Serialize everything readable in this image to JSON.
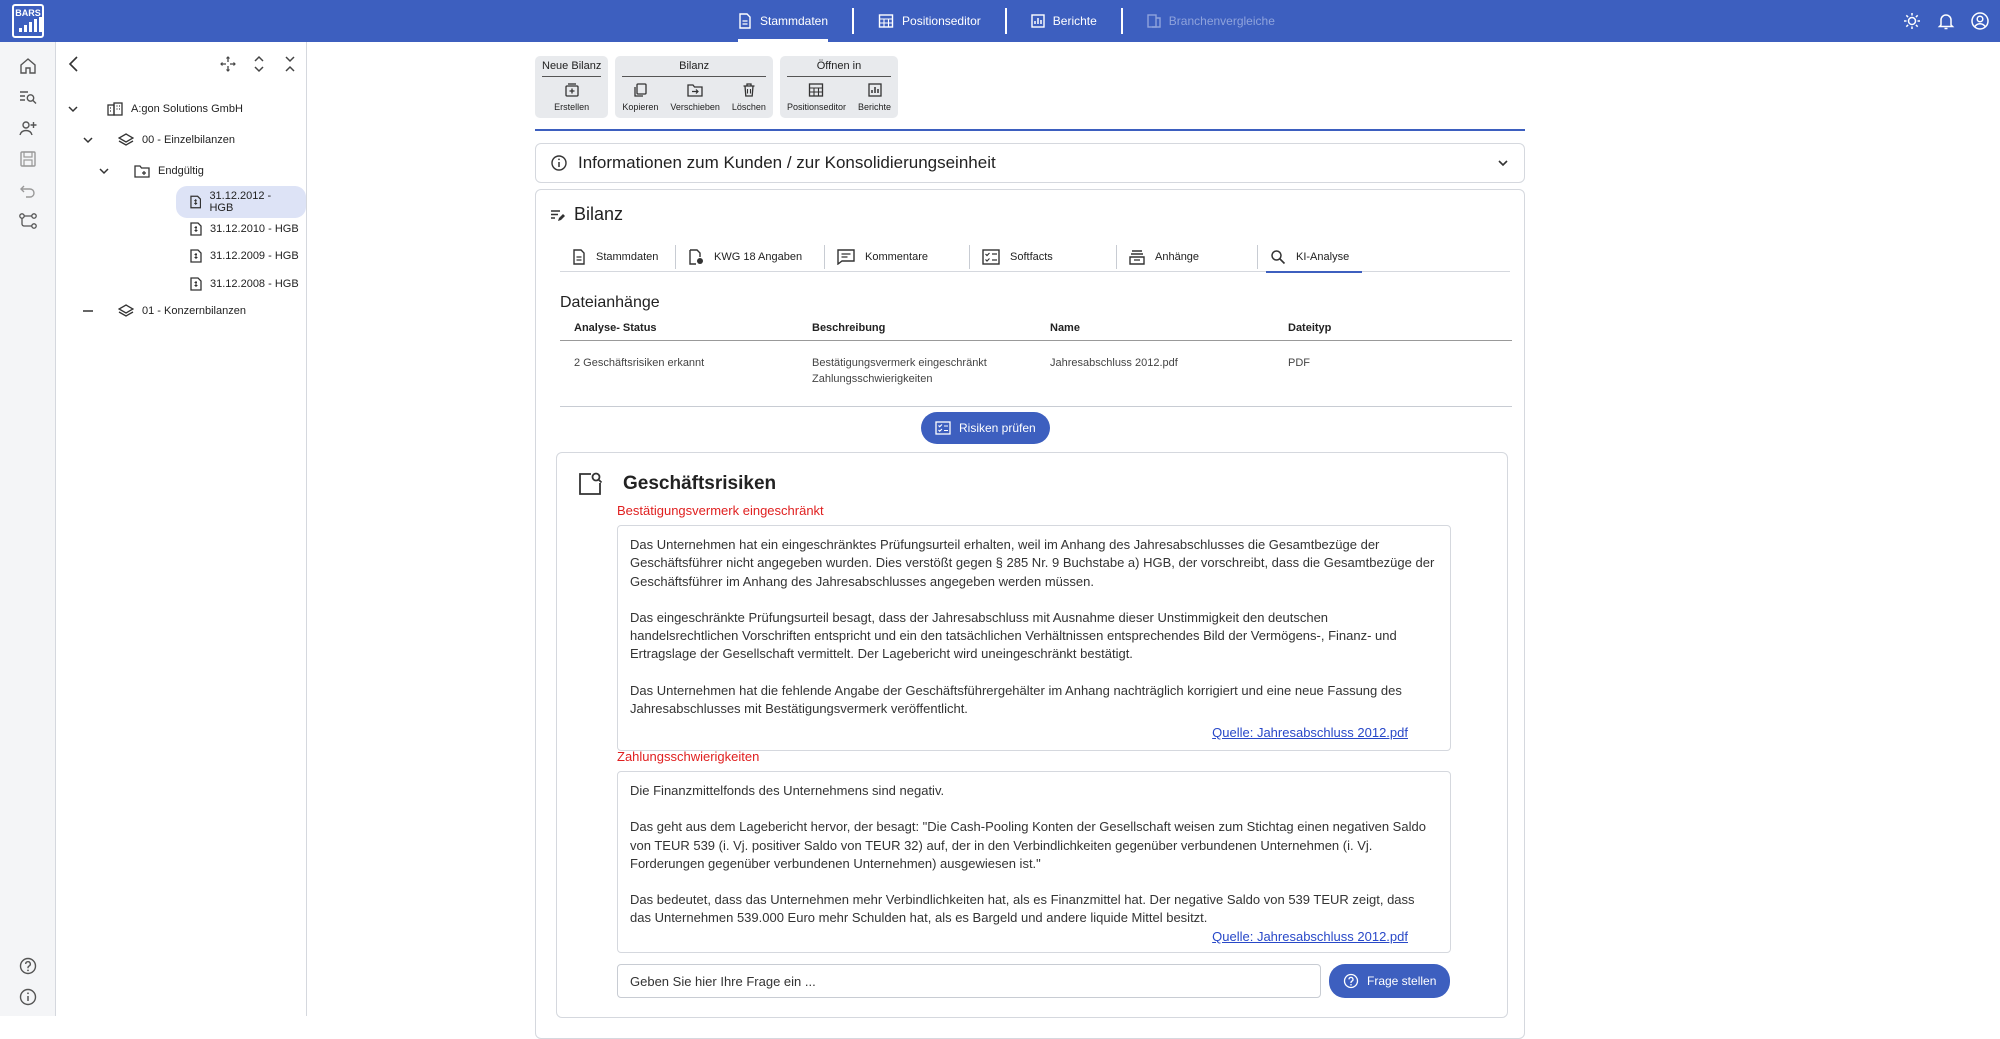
{
  "app": {
    "logo_text": "BARS"
  },
  "nav": {
    "tabs": [
      {
        "label": "Stammdaten"
      },
      {
        "label": "Positionseditor"
      },
      {
        "label": "Berichte"
      },
      {
        "label": "Branchenvergleiche"
      }
    ]
  },
  "tree": {
    "nodes": [
      {
        "label": "A:gon Solutions GmbH"
      },
      {
        "label": "00 - Einzelbilanzen"
      },
      {
        "label": "Endgültig"
      },
      {
        "label": "31.12.2012 - HGB"
      },
      {
        "label": "31.12.2010 - HGB"
      },
      {
        "label": "31.12.2009 - HGB"
      },
      {
        "label": "31.12.2008 - HGB"
      },
      {
        "label": "01 - Konzernbilanzen"
      }
    ]
  },
  "ribbon": {
    "groups": [
      {
        "title": "Neue Bilanz",
        "buttons": [
          {
            "label": "Erstellen"
          }
        ]
      },
      {
        "title": "Bilanz",
        "buttons": [
          {
            "label": "Kopieren"
          },
          {
            "label": "Verschieben"
          },
          {
            "label": "Löschen"
          }
        ]
      },
      {
        "title": "Öffnen in",
        "buttons": [
          {
            "label": "Positionseditor"
          },
          {
            "label": "Berichte"
          }
        ]
      }
    ]
  },
  "info": {
    "title": "Informationen zum Kunden / zur Konsolidierungseinheit"
  },
  "card": {
    "title": "Bilanz",
    "tabs": [
      {
        "label": "Stammdaten"
      },
      {
        "label": "KWG 18 Angaben"
      },
      {
        "label": "Kommentare"
      },
      {
        "label": "Softfacts"
      },
      {
        "label": "Anhänge"
      },
      {
        "label": "KI-Analyse"
      }
    ],
    "section_title": "Dateianhänge",
    "table": {
      "headers": [
        "Analyse- Status",
        "Beschreibung",
        "Name",
        "Dateityp"
      ],
      "rows": [
        {
          "status": "2 Geschäftsrisiken erkannt",
          "desc1": "Bestätigungsvermerk eingeschränkt",
          "desc2": "Zahlungsschwierigkeiten",
          "name": "Jahresabschluss 2012.pdf",
          "type": "PDF"
        }
      ]
    },
    "check_button": "Risiken prüfen"
  },
  "risks": {
    "title": "Geschäftsrisiken",
    "items": [
      {
        "label": "Bestätigungsvermerk eingeschränkt",
        "p1": "Das Unternehmen hat ein eingeschränktes Prüfungsurteil erhalten, weil im Anhang des Jahresabschlusses die Gesamtbezüge der Geschäftsführer nicht angegeben wurden. Dies verstößt gegen § 285 Nr. 9 Buchstabe a) HGB, der vorschreibt, dass die Gesamtbezüge der Geschäftsführer im Anhang des Jahresabschlusses angegeben werden müssen.",
        "p2": "Das eingeschränkte Prüfungsurteil besagt, dass der Jahresabschluss mit Ausnahme dieser Unstimmigkeit den deutschen handelsrechtlichen Vorschriften entspricht und ein den tatsächlichen Verhältnissen entsprechendes Bild der Vermögens-, Finanz- und Ertragslage der Gesellschaft vermittelt. Der Lagebericht wird uneingeschränkt bestätigt.",
        "p3": "Das Unternehmen hat die fehlende Angabe der Geschäftsführergehälter im Anhang nachträglich korrigiert und eine neue Fassung des Jahresabschlusses mit Bestätigungsvermerk veröffentlicht.",
        "source": "Quelle: Jahresabschluss 2012.pdf"
      },
      {
        "label": "Zahlungsschwierigkeiten",
        "p1": "Die Finanzmittelfonds des Unternehmens sind negativ.",
        "p2": "Das geht aus dem Lagebericht hervor, der besagt: \"Die Cash-Pooling Konten der Gesellschaft weisen zum Stichtag einen negativen Saldo von TEUR 539 (i. Vj. positiver Saldo von TEUR 32) auf, der in den Verbindlichkeiten gegenüber verbundenen Unternehmen (i. Vj. Forderungen gegenüber verbundenen Unternehmen) ausgewiesen ist.\"",
        "p3": "Das bedeutet, dass das Unternehmen mehr Verbindlichkeiten hat, als es Finanzmittel hat. Der negative Saldo von 539 TEUR zeigt, dass das Unternehmen 539.000 Euro mehr Schulden hat, als es Bargeld und andere liquide Mittel besitzt.",
        "source": "Quelle: Jahresabschluss 2012.pdf"
      }
    ],
    "question_placeholder": "Geben Sie hier Ihre Frage ein ...",
    "ask_button": "Frage stellen"
  }
}
